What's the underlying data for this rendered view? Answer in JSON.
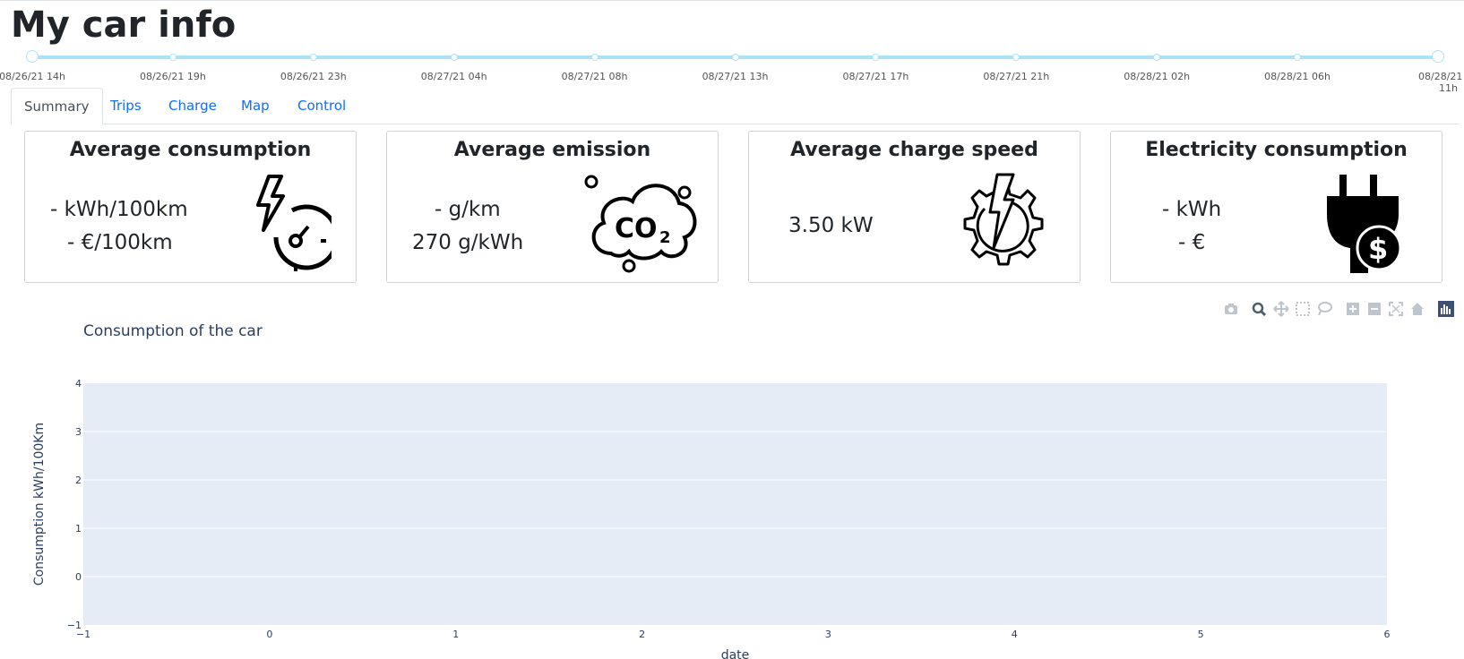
{
  "page": {
    "title": "My car info"
  },
  "slider": {
    "labels": [
      "08/26/21 14h",
      "08/26/21 19h",
      "08/26/21 23h",
      "08/27/21 04h",
      "08/27/21 08h",
      "08/27/21 13h",
      "08/27/21 17h",
      "08/27/21 21h",
      "08/28/21 02h",
      "08/28/21 06h",
      "08/28/21 11h"
    ],
    "range_start_label": "08/26/21 14h",
    "range_end_label": "08/28/21 11h",
    "color": "#abe2fb"
  },
  "tabs": [
    "Summary",
    "Trips",
    "Charge",
    "Map",
    "Control"
  ],
  "active_tab": "Summary",
  "cards": {
    "consumption": {
      "title": "Average consumption",
      "line1": "- kWh/100km",
      "line2": "- €/100km",
      "icon": "lightning-gauge-icon"
    },
    "emission": {
      "title": "Average emission",
      "line1": "- g/km",
      "line2": "270 g/kWh",
      "icon": "co2-cloud-icon"
    },
    "charge_speed": {
      "title": "Average charge speed",
      "line1": "3.50 kW",
      "icon": "lightning-gear-icon"
    },
    "electricity": {
      "title": "Electricity consumption",
      "line1": "- kWh",
      "line2": "- €",
      "icon": "plug-dollar-icon"
    }
  },
  "modebar": [
    "camera-icon",
    "zoom-icon",
    "pan-icon",
    "box-select-icon",
    "lasso-icon",
    "zoom-in-icon",
    "zoom-out-icon",
    "autoscale-icon",
    "reset-axes-icon",
    "plotly-logo-icon"
  ],
  "chart_data": {
    "type": "line",
    "title": "Consumption of the car",
    "xlabel": "date",
    "ylabel": "Consumption kWh/100Km",
    "xlim": [
      -1,
      6
    ],
    "ylim": [
      -1,
      4
    ],
    "xticks": [
      "−1",
      "0",
      "1",
      "2",
      "3",
      "4",
      "5",
      "6"
    ],
    "yticks": [
      "−1",
      "0",
      "1",
      "2",
      "3",
      "4"
    ],
    "series": [],
    "grid": true,
    "plot_bg": "#e5ecf6"
  }
}
